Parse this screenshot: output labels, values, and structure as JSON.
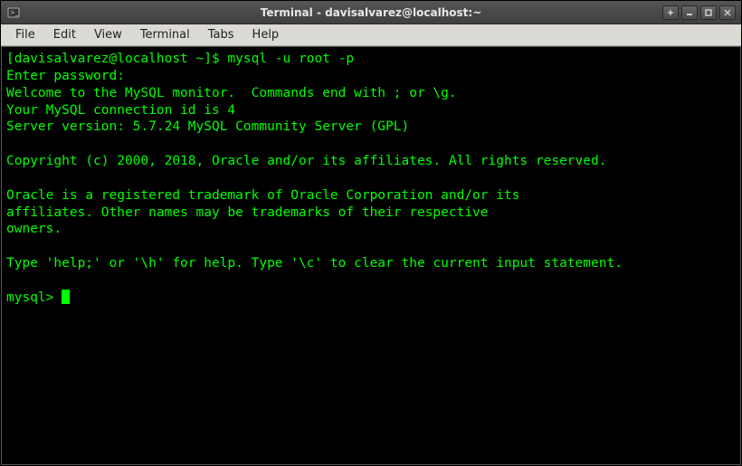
{
  "window": {
    "title": "Terminal - davisalvarez@localhost:~"
  },
  "menubar": {
    "items": [
      "File",
      "Edit",
      "View",
      "Terminal",
      "Tabs",
      "Help"
    ]
  },
  "terminal": {
    "prompt_line": "[davisalvarez@localhost ~]$ mysql -u root -p",
    "lines": [
      "Enter password:",
      "Welcome to the MySQL monitor.  Commands end with ; or \\g.",
      "Your MySQL connection id is 4",
      "Server version: 5.7.24 MySQL Community Server (GPL)",
      "",
      "Copyright (c) 2000, 2018, Oracle and/or its affiliates. All rights reserved.",
      "",
      "Oracle is a registered trademark of Oracle Corporation and/or its",
      "affiliates. Other names may be trademarks of their respective",
      "owners.",
      "",
      "Type 'help;' or '\\h' for help. Type '\\c' to clear the current input statement.",
      ""
    ],
    "current_prompt": "mysql> "
  }
}
